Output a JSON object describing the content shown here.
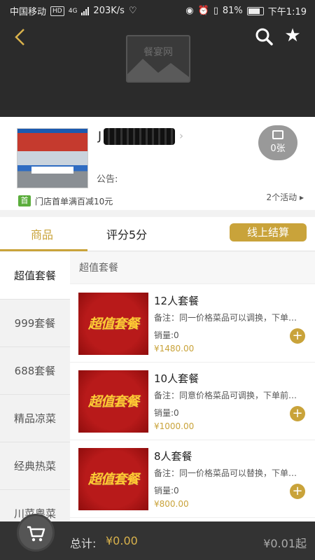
{
  "status": {
    "carrier": "中国移动",
    "hd": "HD",
    "net": "4G",
    "speed": "203K/s",
    "battery": "81%",
    "time": "下午1:19"
  },
  "header": {
    "logo_text": "餐宴网"
  },
  "shop": {
    "name_visible": "J",
    "photo_count": "0张",
    "notice_label": "公告:",
    "promo_badge": "首",
    "promo_text": "门店首单满百减10元",
    "activity_link": "2个活动 ▸"
  },
  "tabs": {
    "goods": "商品",
    "rating": "评分5分",
    "checkout": "线上结算"
  },
  "categories": [
    "超值套餐",
    "999套餐",
    "688套餐",
    "精品凉菜",
    "经典热菜",
    "川菜粤菜"
  ],
  "section_title": "超值套餐",
  "image_tag": "超值套餐",
  "products": [
    {
      "name": "12人套餐",
      "note": "备注：同一价格菜品可以调换，下单前请与店家沟通",
      "sales": "销量:0",
      "price": "¥1480.00"
    },
    {
      "name": "10人套餐",
      "note": "备注：同意价格菜品可调换，下单前请与店家沟通",
      "sales": "销量:0",
      "price": "¥1000.00"
    },
    {
      "name": "8人套餐",
      "note": "备注：同一价格菜品可以替换，下单前请与店家沟通",
      "sales": "销量:0",
      "price": "¥800.00"
    }
  ],
  "bottom": {
    "total_label": "总计:",
    "total_value": "¥0.00",
    "min_order": "¥0.01起"
  },
  "colors": {
    "accent": "#c9a33a",
    "header_bg": "#2b2b2b",
    "promo_green": "#5bad3c"
  }
}
